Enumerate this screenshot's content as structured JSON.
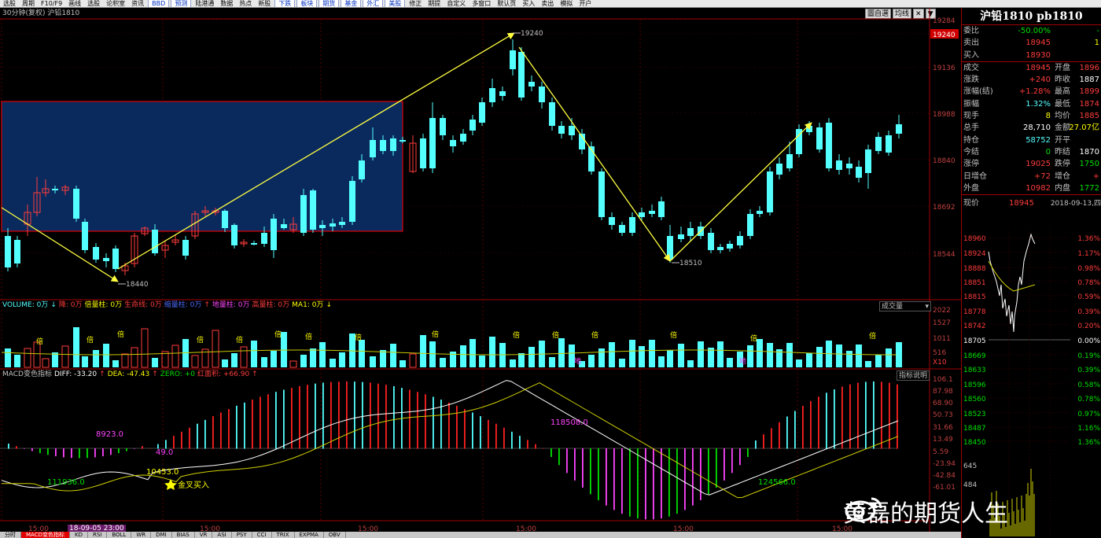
{
  "toolbar": {
    "items": [
      "选股",
      "周期",
      "F10/F9",
      "画线",
      "选股",
      "论积室",
      "资讯",
      "BBD",
      "预测",
      "陆港通",
      "数据",
      "热点",
      "新股",
      "下跌",
      "板块",
      "期货",
      "基金",
      "外汇",
      "美股",
      "修正",
      "期提",
      "自定义",
      "多窗口",
      "默认页",
      "买入",
      "卖出",
      "模拟",
      "开户"
    ],
    "highlighted": [
      7,
      8,
      13,
      14,
      15,
      16,
      17,
      18
    ]
  },
  "title_bar": {
    "text": "30分钟(复权) 沪铅1810"
  },
  "chart_controls": [
    "圖自選",
    "均线",
    "✕",
    "▼"
  ],
  "main_chart": {
    "price_axis": [
      "19284",
      "19240",
      "19136",
      "18988",
      "18840",
      "18692",
      "18544"
    ],
    "price_axis_current": "19240",
    "annotations": {
      "high_label": "19240",
      "low_label_1": "18440",
      "low_label_2": "18510"
    }
  },
  "volume_panel": {
    "legend": [
      {
        "text": "VOLUME: 0万",
        "color": "#54ffff"
      },
      {
        "text": "↓",
        "color": "#54ffff"
      },
      {
        "text": "降: 0万",
        "color": "#ff3c3c"
      },
      {
        "text": "倍量柱: 0万",
        "color": "#ffff00"
      },
      {
        "text": "生命线: 0万",
        "color": "#ff3c3c"
      },
      {
        "text": "缩量柱: 0万",
        "color": "#4c6bff"
      },
      {
        "text": "↑",
        "color": "#ff3c3c"
      },
      {
        "text": "地量柱: 0万",
        "color": "#ff44ff"
      },
      {
        "text": "高量柱: 0万",
        "color": "#ff3c3c"
      },
      {
        "text": "MA1: 0万",
        "color": "#ffff00"
      },
      {
        "text": "↓",
        "color": "#ffff00"
      }
    ],
    "dropdown_label": "成交量",
    "axis": [
      "2022",
      "1527",
      "1011",
      "516",
      "X10"
    ],
    "bei_label": "倍",
    "di_label": "地"
  },
  "macd_panel": {
    "legend": [
      {
        "text": "MACD变色指标",
        "color": "#c0c0c0"
      },
      {
        "text": "DIFF: -33.20",
        "color": "#ffffff"
      },
      {
        "text": "↑",
        "color": "#ff3c3c"
      },
      {
        "text": "DEA: -47.43",
        "color": "#ffff00"
      },
      {
        "text": "↑",
        "color": "#ff3c3c"
      },
      {
        "text": "ZERO: +0",
        "color": "#00e000"
      },
      {
        "text": "红面积: +66.90",
        "color": "#ff3c3c"
      },
      {
        "text": "↑",
        "color": "#ff3c3c"
      }
    ],
    "explain_button": "指标说明",
    "axis": [
      "106.1",
      "87.98",
      "68.90",
      "50.73",
      "31.66",
      "13.49",
      "5.59",
      "-23.94",
      "-42.84",
      "-61.01"
    ],
    "labels": {
      "a": "8923.0",
      "b": "49.0",
      "c": "111936.0",
      "d": "10453.0",
      "e": "金叉买入",
      "f": "118508.0",
      "g": "124566.0"
    }
  },
  "time_axis": {
    "labels": [
      "15:00",
      "15:00",
      "15:00",
      "15:00",
      "15:00",
      "15:00"
    ],
    "date_marker": "18-09-05 23:00"
  },
  "side_panel": {
    "title": "沪铅1810 pb1810",
    "rows_top": [
      {
        "lbl": "委比",
        "v1": "-50.00%",
        "c1": "green",
        "lbl2": "",
        "v2": "-",
        "c2": "green"
      },
      {
        "lbl": "卖出",
        "v1": "18945",
        "c1": "red",
        "lbl2": "",
        "v2": "1",
        "c2": "yellow"
      },
      {
        "lbl": "买入",
        "v1": "18930",
        "c1": "red",
        "lbl2": "",
        "v2": "",
        "c2": "yellow"
      }
    ],
    "rows_mid": [
      {
        "lbl": "成交",
        "v1": "18945",
        "c1": "red",
        "lbl2": "开盘",
        "v2": "1896",
        "c2": "red"
      },
      {
        "lbl": "涨跌",
        "v1": "+240",
        "c1": "red",
        "lbl2": "昨收",
        "v2": "1887",
        "c2": "white"
      },
      {
        "lbl": "涨幅(结)",
        "v1": "+1.28%",
        "c1": "red",
        "lbl2": "最高",
        "v2": "1899",
        "c2": "red"
      },
      {
        "lbl": "振幅",
        "v1": "1.32%",
        "c1": "cyan",
        "lbl2": "最低",
        "v2": "1874",
        "c2": "red"
      },
      {
        "lbl": "现手",
        "v1": "8",
        "c1": "yellow",
        "lbl2": "均价",
        "v2": "1885",
        "c2": "red"
      },
      {
        "lbl": "总手",
        "v1": "28,710",
        "c1": "white",
        "lbl2": "金额",
        "v2": "27.07亿",
        "c2": "yellow"
      },
      {
        "lbl": "持仓",
        "v1": "58752",
        "c1": "cyan",
        "lbl2": "开平",
        "v2": "",
        "c2": "white"
      },
      {
        "lbl": "今结",
        "v1": "0",
        "c1": "green",
        "lbl2": "昨结",
        "v2": "1870",
        "c2": "white"
      },
      {
        "lbl": "涨停",
        "v1": "19025",
        "c1": "red",
        "lbl2": "跌停",
        "v2": "1750",
        "c2": "green"
      },
      {
        "lbl": "日增仓",
        "v1": "+72",
        "c1": "red",
        "lbl2": "增仓",
        "v2": "+",
        "c2": "red"
      },
      {
        "lbl": "外盘",
        "v1": "10982",
        "c1": "red",
        "lbl2": "内盘",
        "v2": "1772",
        "c2": "green"
      }
    ],
    "tick": {
      "lbl": "现价",
      "price": "18945",
      "datetime": "2018-09-13,四"
    },
    "mini_left_axis": [
      "18960",
      "18924",
      "18888",
      "18851",
      "18815",
      "18778",
      "18742",
      "18705",
      "18669",
      "18633",
      "18596",
      "18560",
      "18523",
      "18487",
      "18450",
      "645",
      "484"
    ],
    "mini_right_axis": [
      "1.36%",
      "1.17%",
      "0.98%",
      "0.78%",
      "0.59%",
      "0.39%",
      "0.20%",
      "0.00%",
      "0.19%",
      "0.39%",
      "0.58%",
      "0.78%",
      "0.97%",
      "1.16%",
      "1.36%"
    ]
  },
  "watermark": {
    "text": "黄磊的期货人生"
  },
  "bottom_tabs": [
    "分时",
    "MACD变色指标",
    "KD",
    "RSI",
    "BOLL",
    "WR",
    "DMI",
    "BIAS",
    "VR",
    "ASI",
    "PSY",
    "CCI",
    "TRIX",
    "EXPMA",
    "OBV"
  ],
  "bottom_tab_active": 1
}
